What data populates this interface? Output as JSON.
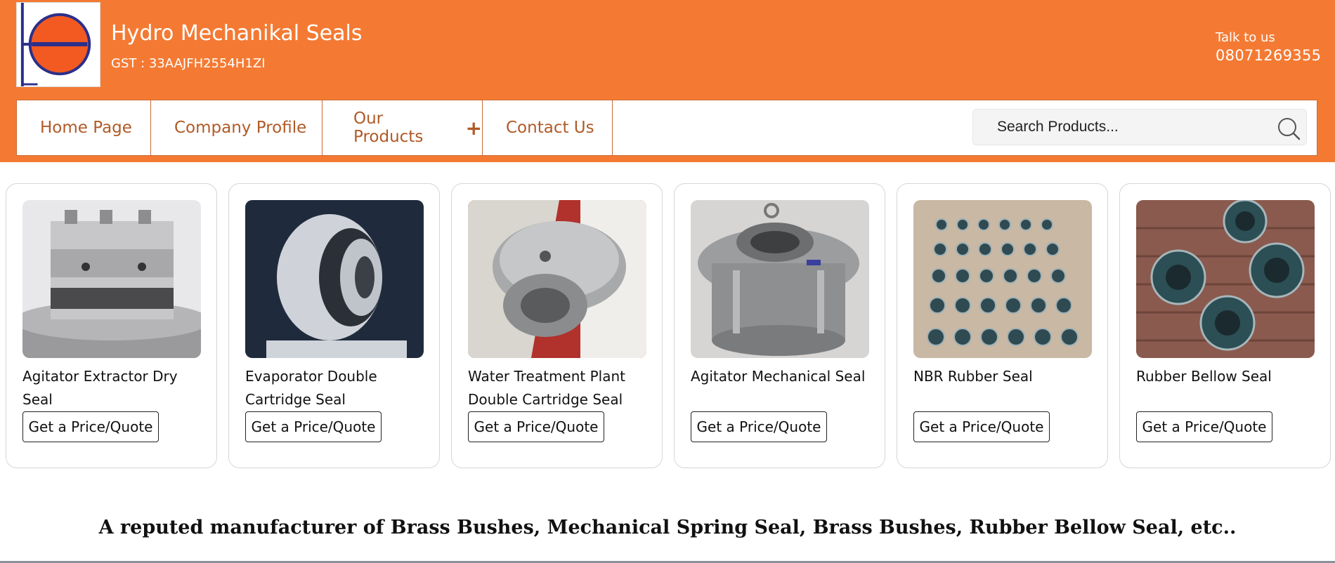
{
  "header": {
    "company_name": "Hydro Mechanikal Seals",
    "gst": "GST : 33AAJFH2554H1ZI",
    "talk_label": "Talk to us",
    "phone": "08071269355",
    "brand_color": "#f47a33",
    "nav_text_color": "#b05a27"
  },
  "nav": {
    "items": [
      {
        "label": "Home Page"
      },
      {
        "label": "Company Profile"
      },
      {
        "label": "Our Products",
        "expand": "+"
      },
      {
        "label": "Contact Us"
      }
    ]
  },
  "search": {
    "placeholder": "Search Products...",
    "icon": "search-icon"
  },
  "products": [
    {
      "name": "Agitator Extractor Dry Seal",
      "button": "Get a Price/Quote"
    },
    {
      "name": "Evaporator Double Cartridge Seal",
      "button": "Get a Price/Quote"
    },
    {
      "name": "Water Treatment Plant Double Cartridge Seal",
      "button": "Get a Price/Quote"
    },
    {
      "name": "Agitator Mechanical Seal",
      "button": "Get a Price/Quote"
    },
    {
      "name": "NBR Rubber Seal",
      "button": "Get a Price/Quote"
    },
    {
      "name": "Rubber Bellow Seal",
      "button": "Get a Price/Quote"
    }
  ],
  "tagline": "A reputed manufacturer of Brass Bushes, Mechanical Spring Seal, Brass Bushes, Rubber Bellow Seal, etc.."
}
